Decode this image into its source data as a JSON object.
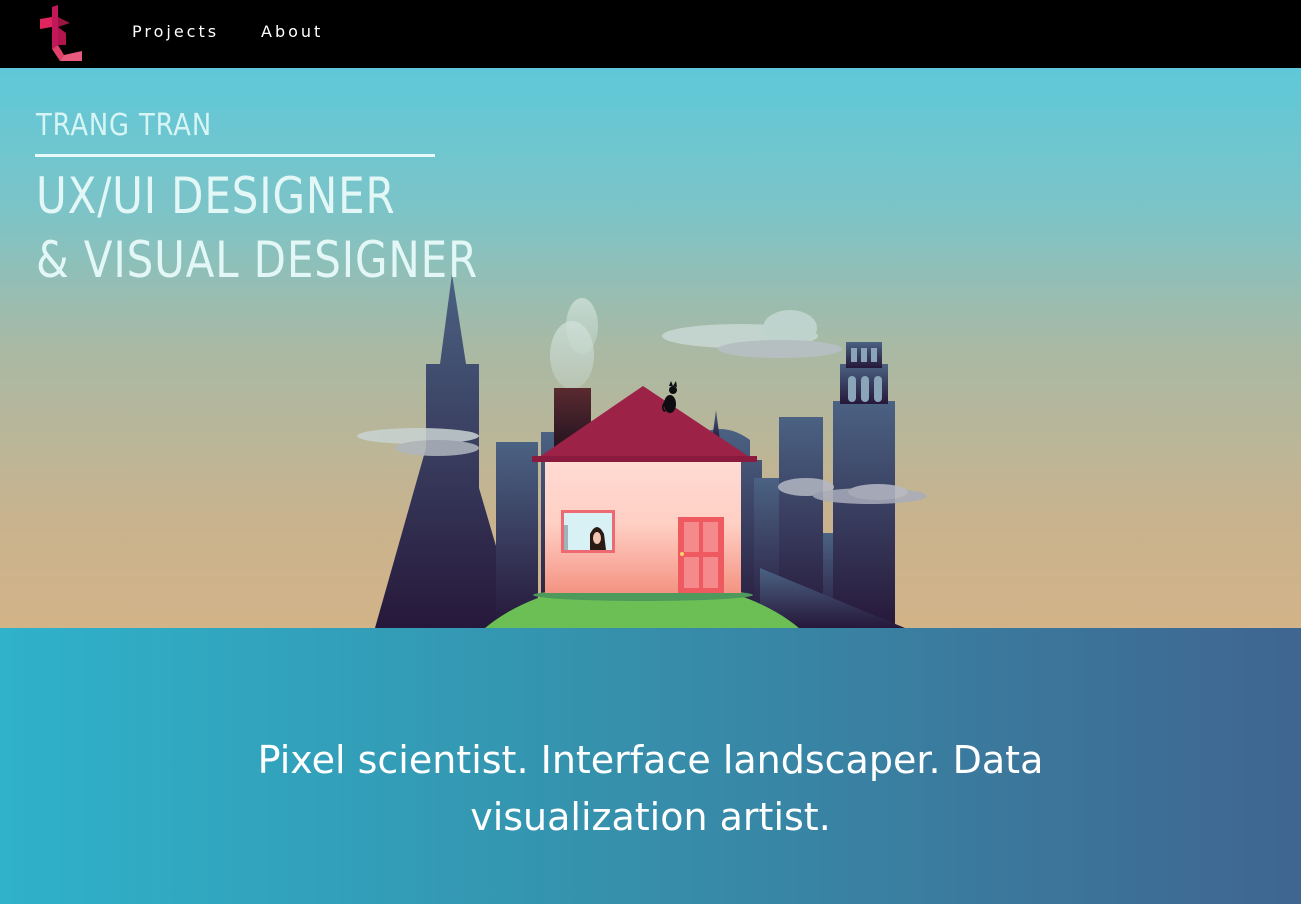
{
  "nav": {
    "logo_icon": "t-monogram-logo-icon",
    "links": [
      {
        "label": "Projects"
      },
      {
        "label": "About"
      }
    ]
  },
  "hero": {
    "name": "TRANG TRAN",
    "role_line1": "UX/UI DESIGNER",
    "role_line2": "& VISUAL DESIGNER",
    "illustration_icon": "house-on-hill-city-skyline-illustration"
  },
  "tagline": {
    "line1": "Pixel scientist. Interface landscaper. Data",
    "line2": "visualization artist."
  },
  "colors": {
    "nav_bg": "#000000",
    "accent": "#c2185b",
    "roof": "#9c2248",
    "door": "#ee5a5f",
    "hill": "#6cbf55",
    "skyline": "#3d3a66",
    "tagline_gradient_start": "#2fb2cb",
    "tagline_gradient_end": "#3f6590"
  }
}
